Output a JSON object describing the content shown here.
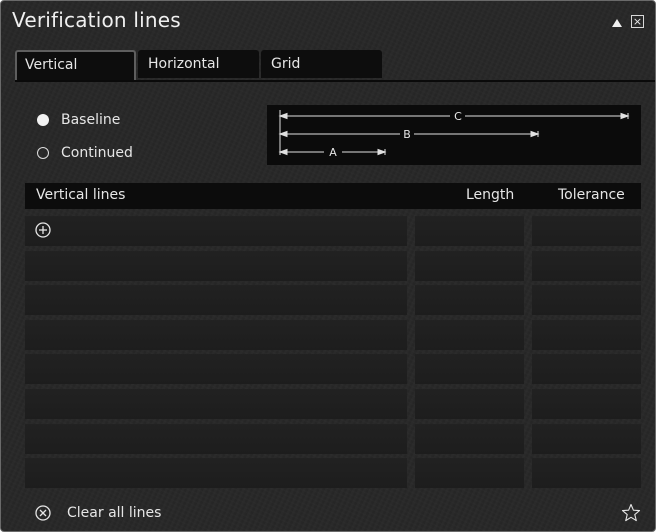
{
  "window": {
    "title": "Verification lines",
    "collapse_icon": "triangle-up-icon",
    "close_icon": "close-icon"
  },
  "tabs": [
    {
      "label": "Vertical",
      "active": true
    },
    {
      "label": "Horizontal",
      "active": false
    },
    {
      "label": "Grid",
      "active": false
    }
  ],
  "mode": {
    "options": [
      {
        "label": "Baseline",
        "selected": true
      },
      {
        "label": "Continued",
        "selected": false
      }
    ]
  },
  "diagram": {
    "labels": [
      "C",
      "B",
      "A"
    ]
  },
  "table": {
    "columns": [
      "Vertical lines",
      "Length",
      "Tolerance"
    ],
    "row_count": 8,
    "add_icon": "plus-circle-icon"
  },
  "footer": {
    "clear_label": "Clear all lines",
    "clear_icon": "x-circle-icon",
    "favorite_icon": "star-outline-icon"
  },
  "colors": {
    "panel_bg": "#272727",
    "dark_bg": "#0c0c0c",
    "cell_bg": "#1e1e1e",
    "text": "#e6e6e6"
  }
}
